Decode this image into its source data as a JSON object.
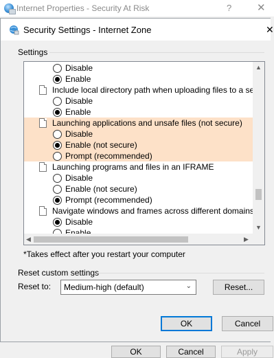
{
  "parent": {
    "title": "Internet Properties - Security At Risk",
    "help_icon": "?",
    "close_icon": "✕",
    "buttons": {
      "ok": "OK",
      "cancel": "Cancel",
      "apply": "Apply"
    }
  },
  "dialog": {
    "title": "Security Settings - Internet Zone",
    "close_icon": "✕",
    "settings_label": "Settings",
    "settings_rows": [
      {
        "kind": "radio",
        "label": "Disable",
        "checked": false,
        "highlight": false
      },
      {
        "kind": "radio",
        "label": "Enable",
        "checked": true,
        "highlight": false
      },
      {
        "kind": "header",
        "label": "Include local directory path when uploading files to a server",
        "highlight": false
      },
      {
        "kind": "radio",
        "label": "Disable",
        "checked": false,
        "highlight": false
      },
      {
        "kind": "radio",
        "label": "Enable",
        "checked": true,
        "highlight": false
      },
      {
        "kind": "header",
        "label": "Launching applications and unsafe files (not secure)",
        "highlight": true
      },
      {
        "kind": "radio",
        "label": "Disable",
        "checked": false,
        "highlight": true
      },
      {
        "kind": "radio",
        "label": "Enable (not secure)",
        "checked": true,
        "highlight": true
      },
      {
        "kind": "radio",
        "label": "Prompt (recommended)",
        "checked": false,
        "highlight": true
      },
      {
        "kind": "header",
        "label": "Launching programs and files in an IFRAME",
        "highlight": false
      },
      {
        "kind": "radio",
        "label": "Disable",
        "checked": false,
        "highlight": false
      },
      {
        "kind": "radio",
        "label": "Enable (not secure)",
        "checked": false,
        "highlight": false
      },
      {
        "kind": "radio",
        "label": "Prompt (recommended)",
        "checked": true,
        "highlight": false
      },
      {
        "kind": "header",
        "label": "Navigate windows and frames across different domains",
        "highlight": false
      },
      {
        "kind": "radio",
        "label": "Disable",
        "checked": true,
        "highlight": false
      },
      {
        "kind": "radio",
        "label": "Enable",
        "checked": false,
        "highlight": false
      }
    ],
    "scroll_up_icon": "▲",
    "scroll_down_icon": "▼",
    "scroll_left_icon": "◀",
    "scroll_right_icon": "▶",
    "note": "*Takes effect after you restart your computer",
    "reset_group_label": "Reset custom settings",
    "reset_to_label": "Reset to:",
    "reset_select_value": "Medium-high (default)",
    "reset_select_chevron": "⌄",
    "reset_button": "Reset...",
    "ok_button": "OK",
    "cancel_button": "Cancel"
  },
  "colors": {
    "highlight": "#fde1c8",
    "focus_border": "#0078d7"
  }
}
